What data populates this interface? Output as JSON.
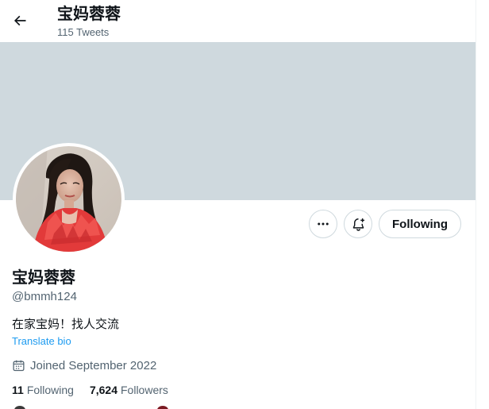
{
  "header": {
    "title": "宝妈蓉蓉",
    "tweet_count": "115 Tweets"
  },
  "profile": {
    "display_name": "宝妈蓉蓉",
    "handle": "@bmmh124",
    "bio": "在家宝妈！找人交流",
    "translate_label": "Translate bio",
    "joined": "Joined September 2022",
    "following_count": "11",
    "following_label": "Following",
    "followers_count": "7,624",
    "followers_label": "Followers"
  },
  "actions": {
    "following_button": "Following"
  },
  "icons": {
    "back": "arrow-left-icon",
    "more": "more-horizontal-icon",
    "notify": "bell-plus-icon",
    "calendar": "calendar-icon"
  },
  "colors": {
    "banner": "#cfd9de",
    "link": "#1d9bf0",
    "muted": "#536471",
    "text": "#0f1419"
  }
}
